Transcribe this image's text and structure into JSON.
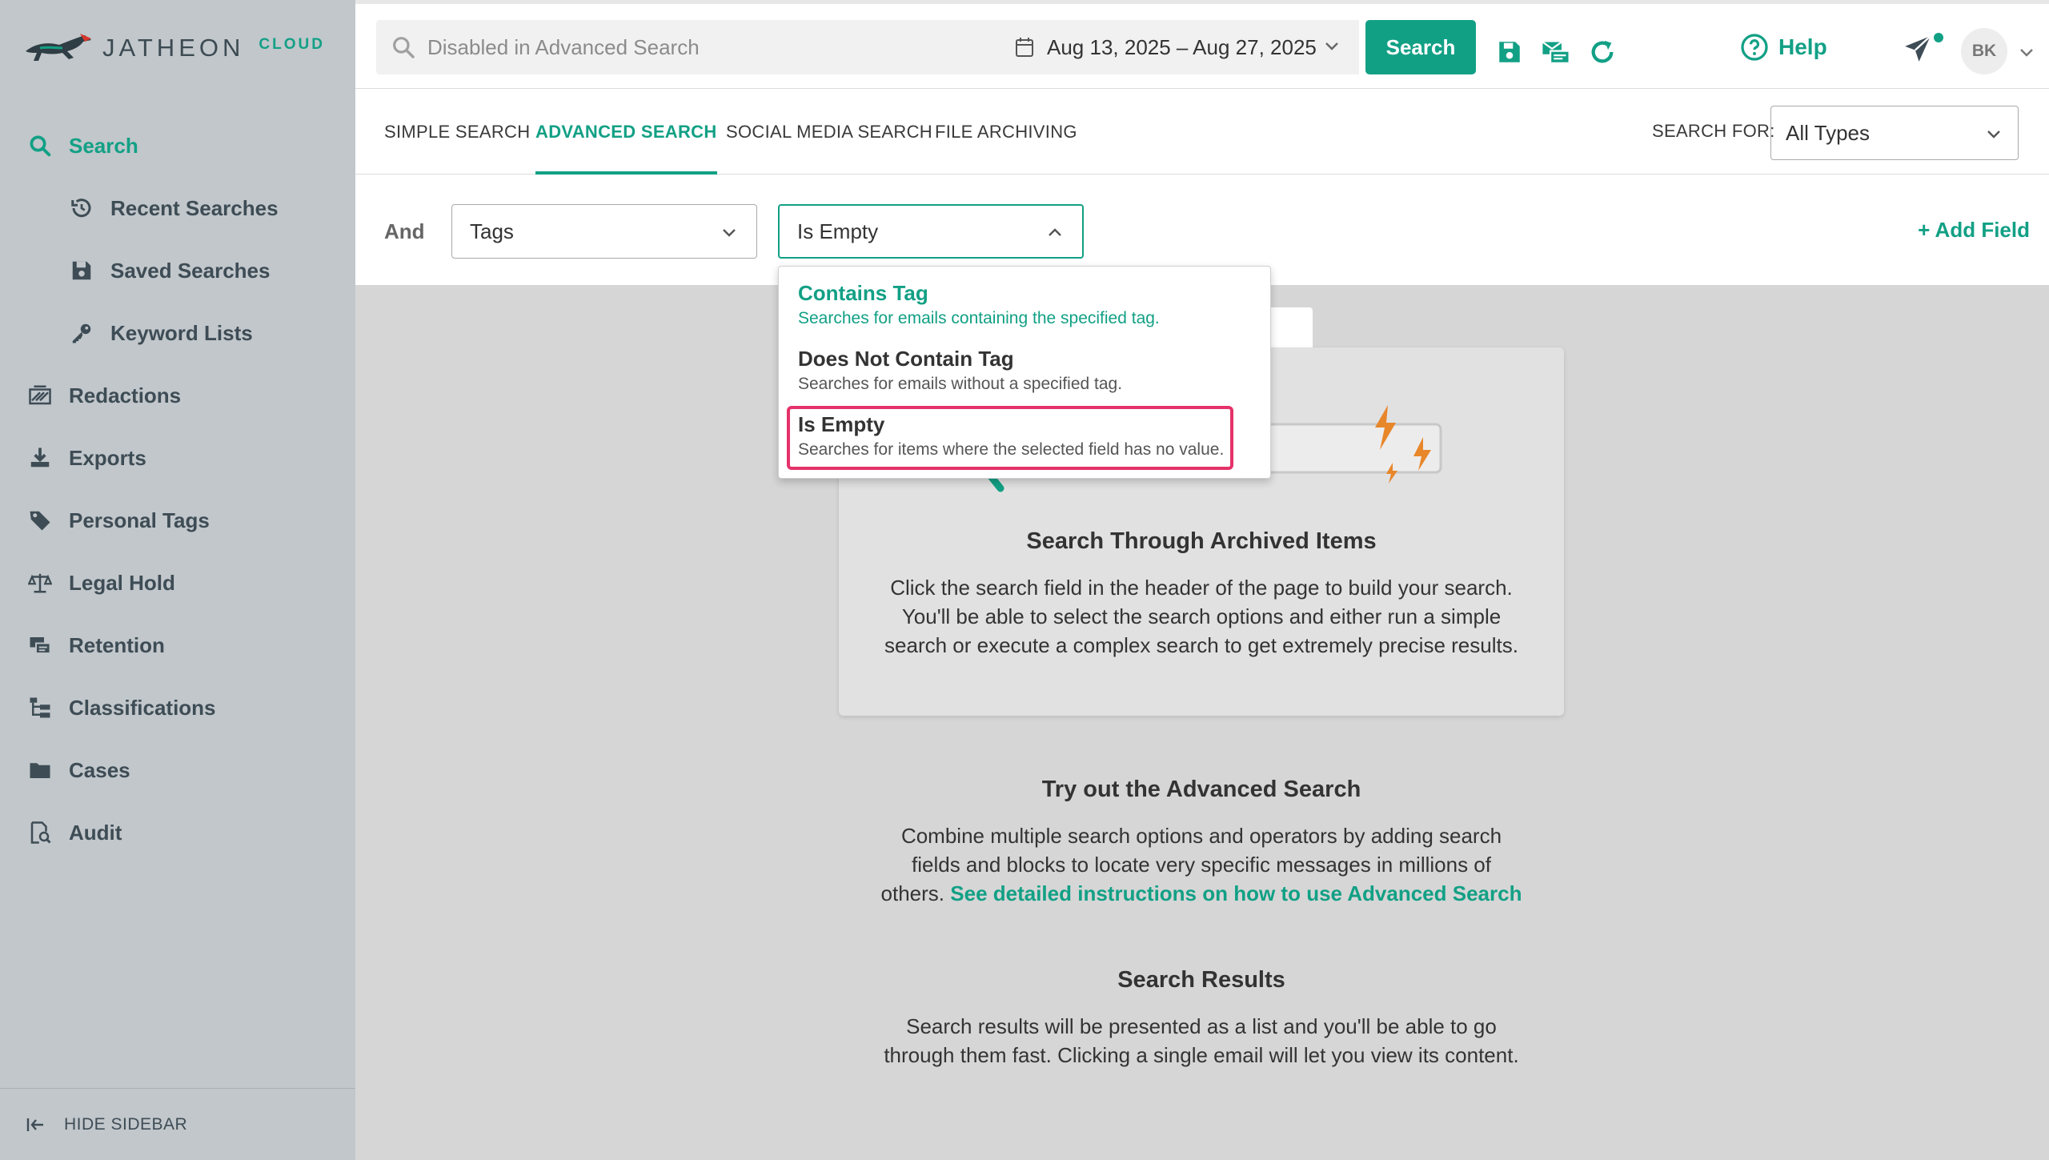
{
  "app": {
    "logo_text": "JATHEON",
    "logo_sub": "CLOUD"
  },
  "sidebar": {
    "items": [
      {
        "label": "Search",
        "icon": "search-icon",
        "active": true
      },
      {
        "label": "Recent Searches",
        "icon": "history-icon",
        "sub": true
      },
      {
        "label": "Saved Searches",
        "icon": "save-icon",
        "sub": true
      },
      {
        "label": "Keyword Lists",
        "icon": "key-icon",
        "sub": true
      },
      {
        "label": "Redactions",
        "icon": "redaction-icon"
      },
      {
        "label": "Exports",
        "icon": "download-icon"
      },
      {
        "label": "Personal Tags",
        "icon": "tag-icon"
      },
      {
        "label": "Legal Hold",
        "icon": "scale-icon"
      },
      {
        "label": "Retention",
        "icon": "retention-icon"
      },
      {
        "label": "Classifications",
        "icon": "hierarchy-icon"
      },
      {
        "label": "Cases",
        "icon": "folder-icon"
      },
      {
        "label": "Audit",
        "icon": "audit-icon"
      }
    ],
    "hide_label": "HIDE SIDEBAR"
  },
  "header": {
    "search_placeholder": "Disabled in Advanced Search",
    "date_range": "Aug 13, 2025 – Aug 27, 2025",
    "search_button": "Search",
    "help_label": "Help",
    "avatar_initials": "BK"
  },
  "tabs": {
    "items": [
      "SIMPLE SEARCH",
      "ADVANCED SEARCH",
      "SOCIAL MEDIA SEARCH",
      "FILE ARCHIVING"
    ],
    "active_index": 1,
    "search_for_label": "SEARCH FOR:",
    "search_for_value": "All Types"
  },
  "field_row": {
    "operator": "And",
    "field_value": "Tags",
    "condition_value": "Is Empty",
    "add_field": "+ Add Field"
  },
  "dropdown": {
    "options": [
      {
        "title": "Contains Tag",
        "desc": "Searches for emails containing the specified tag."
      },
      {
        "title": "Does Not Contain Tag",
        "desc": "Searches for emails without a specified tag."
      },
      {
        "title": "Is Empty",
        "desc": "Searches for items where the selected field has no value."
      }
    ],
    "selected_index": 2
  },
  "content": {
    "card_title": "Search Through Archived Items",
    "card_text": [
      "Click the search field in the header of the page to build your search.",
      "You'll be able to select the search options and either run a simple",
      "search or execute a complex search to get extremely precise results."
    ],
    "advanced_title": "Try out the Advanced Search",
    "advanced_text": [
      "Combine multiple search options and operators by adding search",
      "fields and blocks to locate very specific messages in millions of",
      "others."
    ],
    "advanced_link": "See detailed instructions on how to use Advanced Search",
    "results_title": "Search Results",
    "results_text": [
      "Search results will be presented as a list and you'll be able to go",
      "through them fast. Clicking a single email will let you view its content."
    ]
  },
  "colors": {
    "accent": "#12a085",
    "highlight": "#e5326a",
    "sidebar_bg": "#c1c7cb",
    "lightning": "#e8862a"
  }
}
